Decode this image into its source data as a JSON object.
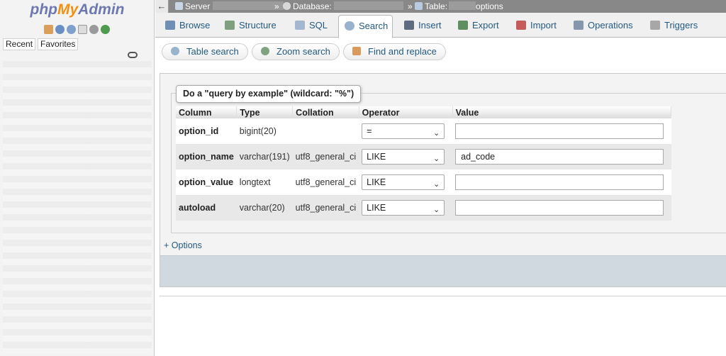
{
  "nav": {
    "logo": {
      "php": "php",
      "my": "My",
      "admin": "Admin"
    },
    "icons": [
      "home-icon",
      "logout-icon",
      "docs-icon",
      "sql-docs-icon",
      "settings-icon",
      "reload-icon"
    ],
    "tabs": {
      "recent": "Recent",
      "favorites": "Favorites"
    }
  },
  "breadcrumb": {
    "server": "Server",
    "separator": "»",
    "database": "Database:",
    "table": "Table:",
    "table_suffix": "options"
  },
  "tabs": [
    {
      "label": "Browse",
      "icon": "browse-icon",
      "active": false
    },
    {
      "label": "Structure",
      "icon": "structure-icon",
      "active": false
    },
    {
      "label": "SQL",
      "icon": "sql-icon",
      "active": false
    },
    {
      "label": "Search",
      "icon": "search-icon",
      "active": true
    },
    {
      "label": "Insert",
      "icon": "insert-icon",
      "active": false
    },
    {
      "label": "Export",
      "icon": "export-icon",
      "active": false
    },
    {
      "label": "Import",
      "icon": "import-icon",
      "active": false
    },
    {
      "label": "Operations",
      "icon": "operations-icon",
      "active": false
    },
    {
      "label": "Triggers",
      "icon": "triggers-icon",
      "active": false
    }
  ],
  "subtabs": [
    {
      "label": "Table search",
      "icon": "magnifier-icon"
    },
    {
      "label": "Zoom search",
      "icon": "zoom-icon"
    },
    {
      "label": "Find and replace",
      "icon": "replace-icon"
    }
  ],
  "search": {
    "legend": "Do a \"query by example\" (wildcard: \"%\")",
    "headers": {
      "column": "Column",
      "type": "Type",
      "collation": "Collation",
      "operator": "Operator",
      "value": "Value"
    },
    "rows": [
      {
        "column": "option_id",
        "type": "bigint(20)",
        "collation": "",
        "operator": "=",
        "value": ""
      },
      {
        "column": "option_name",
        "type": "varchar(191)",
        "collation": "utf8_general_ci",
        "operator": "LIKE",
        "value": "ad_code"
      },
      {
        "column": "option_value",
        "type": "longtext",
        "collation": "utf8_general_ci",
        "operator": "LIKE",
        "value": ""
      },
      {
        "column": "autoload",
        "type": "varchar(20)",
        "collation": "utf8_general_ci",
        "operator": "LIKE",
        "value": ""
      }
    ],
    "options_link": "+ Options"
  },
  "colors": {
    "link": "#235a81",
    "breadcrumb_bg": "#888888",
    "footer_bar": "#d1d9e0"
  }
}
